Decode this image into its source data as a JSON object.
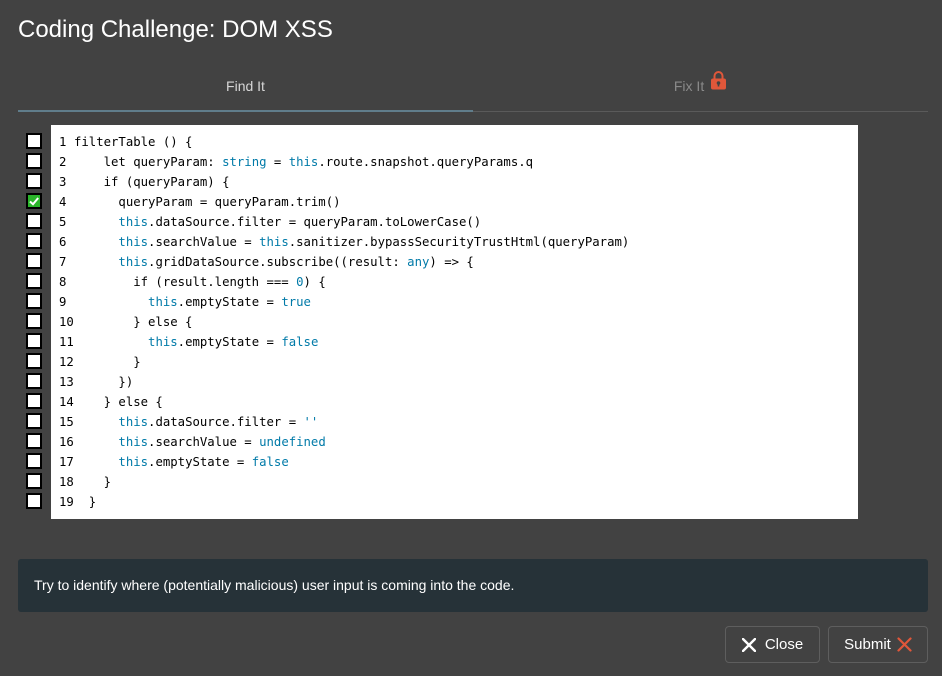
{
  "dialog": {
    "title": "Coding Challenge: DOM XSS"
  },
  "tabs": [
    {
      "label": "Find It",
      "active": true
    },
    {
      "label": "Fix It",
      "locked": true
    }
  ],
  "code": {
    "lines": [
      {
        "num": "1",
        "checked": false,
        "parts": [
          [
            "filterTable () {",
            ""
          ]
        ]
      },
      {
        "num": "2",
        "checked": false,
        "parts": [
          [
            "    let queryParam: ",
            ""
          ],
          [
            "string",
            "kw"
          ],
          [
            " = ",
            ""
          ],
          [
            "this",
            "kw"
          ],
          [
            ".route.snapshot.queryParams.q",
            ""
          ]
        ]
      },
      {
        "num": "3",
        "checked": false,
        "parts": [
          [
            "    if (queryParam) {",
            ""
          ]
        ]
      },
      {
        "num": "4",
        "checked": true,
        "parts": [
          [
            "      queryParam = queryParam.trim()",
            ""
          ]
        ]
      },
      {
        "num": "5",
        "checked": false,
        "parts": [
          [
            "      ",
            ""
          ],
          [
            "this",
            "kw"
          ],
          [
            ".dataSource.filter = queryParam.toLowerCase()",
            ""
          ]
        ]
      },
      {
        "num": "6",
        "checked": false,
        "parts": [
          [
            "      ",
            ""
          ],
          [
            "this",
            "kw"
          ],
          [
            ".searchValue = ",
            ""
          ],
          [
            "this",
            "kw"
          ],
          [
            ".sanitizer.bypassSecurityTrustHtml(queryParam)",
            ""
          ]
        ]
      },
      {
        "num": "7",
        "checked": false,
        "parts": [
          [
            "      ",
            ""
          ],
          [
            "this",
            "kw"
          ],
          [
            ".gridDataSource.subscribe((result: ",
            ""
          ],
          [
            "any",
            "kw"
          ],
          [
            ") => {",
            ""
          ]
        ]
      },
      {
        "num": "8",
        "checked": false,
        "parts": [
          [
            "        if (result.length === ",
            ""
          ],
          [
            "0",
            "kw"
          ],
          [
            ") {",
            ""
          ]
        ]
      },
      {
        "num": "9",
        "checked": false,
        "parts": [
          [
            "          ",
            ""
          ],
          [
            "this",
            "kw"
          ],
          [
            ".emptyState = ",
            ""
          ],
          [
            "true",
            "kw"
          ]
        ]
      },
      {
        "num": "10",
        "checked": false,
        "parts": [
          [
            "        } else {",
            ""
          ]
        ]
      },
      {
        "num": "11",
        "checked": false,
        "parts": [
          [
            "          ",
            ""
          ],
          [
            "this",
            "kw"
          ],
          [
            ".emptyState = ",
            ""
          ],
          [
            "false",
            "kw"
          ]
        ]
      },
      {
        "num": "12",
        "checked": false,
        "parts": [
          [
            "        }",
            ""
          ]
        ]
      },
      {
        "num": "13",
        "checked": false,
        "parts": [
          [
            "      })",
            ""
          ]
        ]
      },
      {
        "num": "14",
        "checked": false,
        "parts": [
          [
            "    } else {",
            ""
          ]
        ]
      },
      {
        "num": "15",
        "checked": false,
        "parts": [
          [
            "      ",
            ""
          ],
          [
            "this",
            "kw"
          ],
          [
            ".dataSource.filter = ",
            ""
          ],
          [
            "''",
            "kw"
          ]
        ]
      },
      {
        "num": "16",
        "checked": false,
        "parts": [
          [
            "      ",
            ""
          ],
          [
            "this",
            "kw"
          ],
          [
            ".searchValue = ",
            ""
          ],
          [
            "undefined",
            "kw"
          ]
        ]
      },
      {
        "num": "17",
        "checked": false,
        "parts": [
          [
            "      ",
            ""
          ],
          [
            "this",
            "kw"
          ],
          [
            ".emptyState = ",
            ""
          ],
          [
            "false",
            "kw"
          ]
        ]
      },
      {
        "num": "18",
        "checked": false,
        "parts": [
          [
            "    }",
            ""
          ]
        ]
      },
      {
        "num": "19",
        "checked": false,
        "parts": [
          [
            "  }",
            ""
          ]
        ]
      }
    ]
  },
  "hint": {
    "text": "Try to identify where (potentially malicious) user input is coming into the code."
  },
  "buttons": {
    "close": "Close",
    "submit": "Submit"
  },
  "colors": {
    "background": "#424242",
    "hint_bg": "#263238",
    "tab_indicator": "#607d8b",
    "accent_red": "#e0573a",
    "check_green": "#2bb52b",
    "keyword": "#007aa8"
  },
  "icons": {
    "lock": "lock-icon",
    "close": "close-icon",
    "submit_status": "cross-icon"
  }
}
